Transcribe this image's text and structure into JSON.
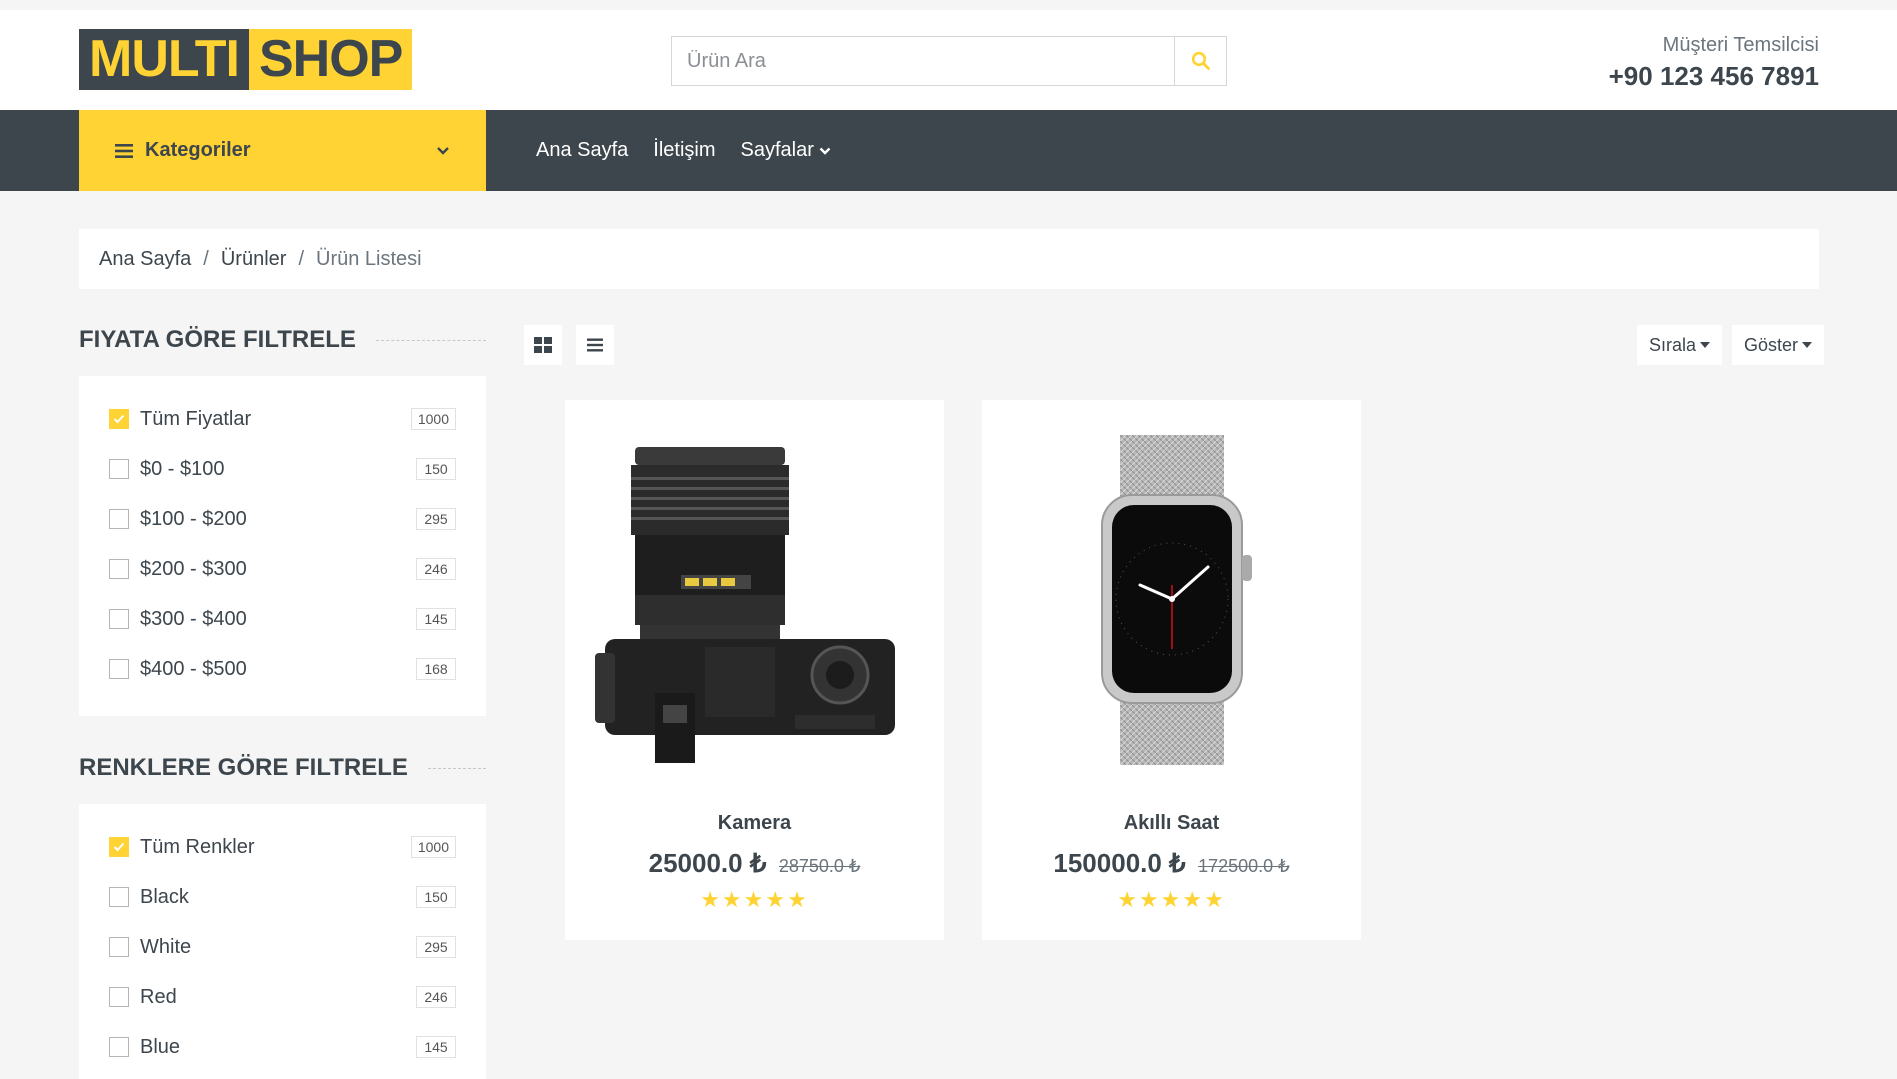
{
  "header": {
    "logo_part1": "MULTI",
    "logo_part2": "SHOP",
    "search_placeholder": "Ürün Ara",
    "contact_label": "Müşteri Temsilcisi",
    "contact_phone": "+90 123 456 7891"
  },
  "nav": {
    "categories_label": "Kategoriler",
    "links": [
      {
        "label": "Ana Sayfa"
      },
      {
        "label": "İletişim"
      },
      {
        "label": "Sayfalar"
      }
    ]
  },
  "breadcrumb": {
    "items": [
      "Ana Sayfa",
      "Ürünler"
    ],
    "current": "Ürün Listesi",
    "separator": "/"
  },
  "price_filter": {
    "title": "FIYATA GÖRE FILTRELE",
    "items": [
      {
        "label": "Tüm Fiyatlar",
        "count": "1000",
        "checked": true
      },
      {
        "label": "$0 - $100",
        "count": "150",
        "checked": false
      },
      {
        "label": "$100 - $200",
        "count": "295",
        "checked": false
      },
      {
        "label": "$200 - $300",
        "count": "246",
        "checked": false
      },
      {
        "label": "$300 - $400",
        "count": "145",
        "checked": false
      },
      {
        "label": "$400 - $500",
        "count": "168",
        "checked": false
      }
    ]
  },
  "color_filter": {
    "title": "RENKLERE GÖRE FILTRELE",
    "items": [
      {
        "label": "Tüm Renkler",
        "count": "1000",
        "checked": true
      },
      {
        "label": "Black",
        "count": "150",
        "checked": false
      },
      {
        "label": "White",
        "count": "295",
        "checked": false
      },
      {
        "label": "Red",
        "count": "246",
        "checked": false
      },
      {
        "label": "Blue",
        "count": "145",
        "checked": false
      }
    ]
  },
  "toolbar": {
    "grid_icon": "grid-icon",
    "list_icon": "list-icon",
    "sort_label": "Sırala",
    "show_label": "Göster"
  },
  "products": [
    {
      "name": "Kamera",
      "price": "25000.0 ₺",
      "old_price": "28750.0 ₺",
      "stars": "★★★★★",
      "rating": 5
    },
    {
      "name": "Akıllı Saat",
      "price": "150000.0 ₺",
      "old_price": "172500.0 ₺",
      "stars": "★★★★★",
      "rating": 5
    }
  ],
  "colors": {
    "accent": "#FFD333",
    "dark": "#3D464D",
    "background": "#F5F5F5"
  }
}
